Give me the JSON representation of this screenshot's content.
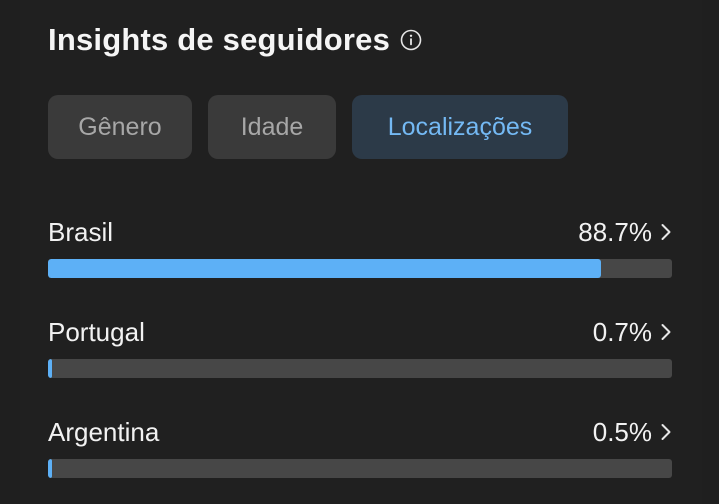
{
  "header": {
    "title": "Insights de seguidores"
  },
  "tabs": [
    {
      "label": "Gênero",
      "active": false
    },
    {
      "label": "Idade",
      "active": false
    },
    {
      "label": "Localizações",
      "active": true
    }
  ],
  "locations": [
    {
      "name": "Brasil",
      "value_label": "88.7%",
      "percent": 88.7
    },
    {
      "name": "Portugal",
      "value_label": "0.7%",
      "percent": 0.7
    },
    {
      "name": "Argentina",
      "value_label": "0.5%",
      "percent": 0.5
    }
  ],
  "colors": {
    "bar_fill": "#5db0f6",
    "bar_track": "#474747",
    "active_tab_text": "#74b9f4",
    "active_tab_bg": "#2c3a48"
  },
  "icons": {
    "info": "info-icon",
    "row_chevron": "chevron-right-icon"
  }
}
